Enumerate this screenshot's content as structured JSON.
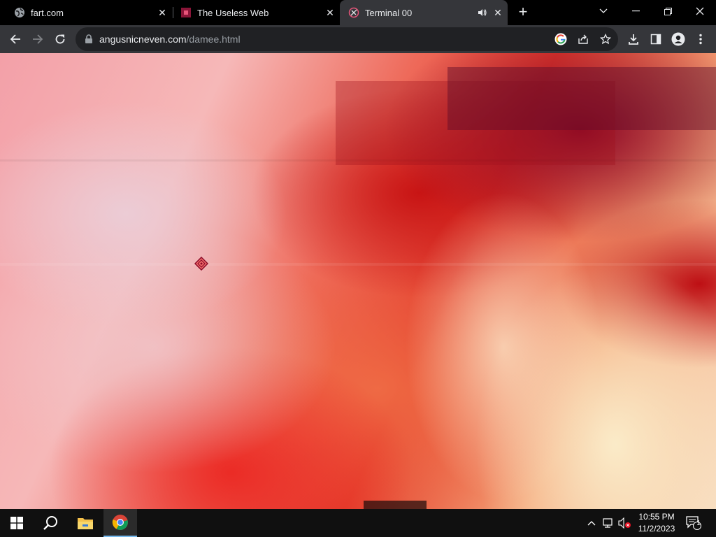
{
  "browser": {
    "tabs": [
      {
        "title": "fart.com",
        "close": "✕",
        "favicon": "globe-icon"
      },
      {
        "title": "The Useless Web",
        "close": "✕",
        "favicon": "useless-web-icon"
      },
      {
        "title": "Terminal 00",
        "close": "✕",
        "favicon": "terminal-icon",
        "audio": "speaker-icon",
        "active": true
      }
    ],
    "new_tab": "+",
    "address_bar": {
      "domain": "angusnicneven.com",
      "path": "/damee.html"
    },
    "window_controls": [
      "chevron-down-icon",
      "minimize-icon",
      "restore-icon",
      "close-icon"
    ],
    "toolbar_icons": [
      "back-icon",
      "forward-icon",
      "reload-icon",
      "google-icon",
      "share-icon",
      "star-icon",
      "download-icon",
      "side-panel-icon",
      "profile-icon",
      "menu-icon"
    ]
  },
  "page": {
    "content": "abstract red glitch image",
    "colors": {
      "accent": "#e23a2a",
      "dark": "#8c0a28",
      "light": "#f8dcc0"
    }
  },
  "taskbar": {
    "pinned": [
      "windows-start-icon",
      "search-icon",
      "file-explorer-icon",
      "chrome-icon"
    ],
    "time": "10:55 PM",
    "date": "11/2/2023",
    "notification_count": "1"
  }
}
